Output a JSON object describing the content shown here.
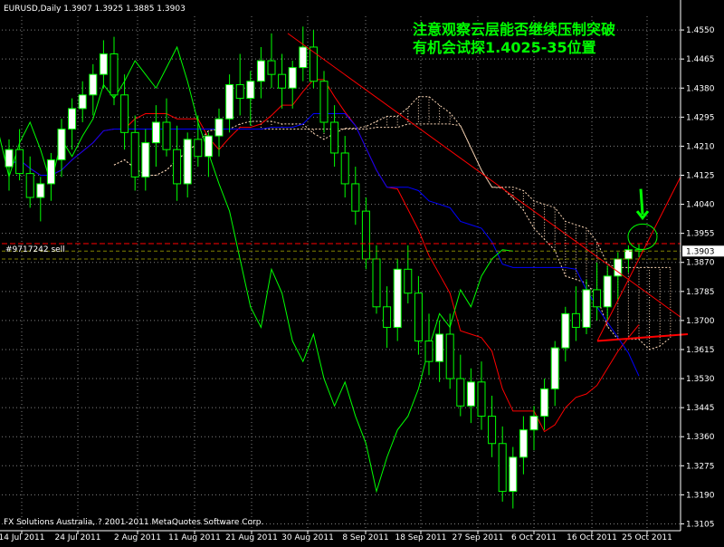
{
  "header": {
    "symbol_line": "EURUSD,Daily  1.3907 1.3925 1.3885 1.3903"
  },
  "annotation": {
    "line1": "注意观察云层能否继续压制突破",
    "line2": "有机会试探1.4025-35位置"
  },
  "order_label": "#9717242 sell",
  "price_marker": "1.3903",
  "footer": "FX Solutions Australia, ? 2001-2011 MetaQuotes Software Corp.",
  "colors": {
    "background": "#000000",
    "grid": "#808080",
    "axis": "#ffffff",
    "bull_candle": "#ffffff",
    "bear_candle": "#000000",
    "wick": "#00ff00",
    "tenkan": "#ff0000",
    "kijun": "#0000ff",
    "chikou": "#00ff00",
    "cloud_a": "#ffdab9",
    "cloud_b": "#ffdab9",
    "trendline": "#ff0000",
    "annotation_text": "#00ff00",
    "order_line": "#ff0000",
    "level_line": "#808000"
  },
  "chart_data": {
    "type": "candlestick",
    "symbol": "EURUSD",
    "timeframe": "Daily",
    "last_bar": {
      "open": 1.3907,
      "high": 1.3925,
      "low": 1.3885,
      "close": 1.3903
    },
    "ylim": [
      1.3085,
      1.459
    ],
    "y_ticks": [
      "1.4550",
      "1.4465",
      "1.4380",
      "1.4295",
      "1.4210",
      "1.4125",
      "1.4040",
      "1.3955",
      "1.3870",
      "1.3785",
      "1.3700",
      "1.3615",
      "1.3530",
      "1.3445",
      "1.3360",
      "1.3275",
      "1.3190",
      "1.3105"
    ],
    "x_ticks": [
      "14 Jul 2011",
      "24 Jul 2011",
      "2 Aug 2011",
      "11 Aug 2011",
      "21 Aug 2011",
      "30 Aug 2011",
      "8 Sep 2011",
      "18 Sep 2011",
      "27 Sep 2011",
      "6 Oct 2011",
      "16 Oct 2011",
      "25 Oct 2011"
    ],
    "grid": true,
    "candles": [
      [
        1.415,
        1.423,
        1.408,
        1.42
      ],
      [
        1.42,
        1.426,
        1.411,
        1.413
      ],
      [
        1.413,
        1.418,
        1.403,
        1.406
      ],
      [
        1.406,
        1.412,
        1.399,
        1.41
      ],
      [
        1.41,
        1.419,
        1.405,
        1.417
      ],
      [
        1.417,
        1.429,
        1.412,
        1.426
      ],
      [
        1.426,
        1.435,
        1.42,
        1.432
      ],
      [
        1.432,
        1.44,
        1.428,
        1.436
      ],
      [
        1.436,
        1.445,
        1.43,
        1.442
      ],
      [
        1.442,
        1.452,
        1.438,
        1.448
      ],
      [
        1.448,
        1.453,
        1.433,
        1.436
      ],
      [
        1.436,
        1.442,
        1.42,
        1.425
      ],
      [
        1.425,
        1.43,
        1.408,
        1.412
      ],
      [
        1.412,
        1.426,
        1.408,
        1.422
      ],
      [
        1.422,
        1.433,
        1.415,
        1.428
      ],
      [
        1.428,
        1.435,
        1.418,
        1.42
      ],
      [
        1.42,
        1.427,
        1.405,
        1.41
      ],
      [
        1.41,
        1.425,
        1.406,
        1.423
      ],
      [
        1.423,
        1.43,
        1.415,
        1.418
      ],
      [
        1.418,
        1.425,
        1.412,
        1.424
      ],
      [
        1.424,
        1.432,
        1.418,
        1.429
      ],
      [
        1.429,
        1.442,
        1.425,
        1.439
      ],
      [
        1.439,
        1.448,
        1.43,
        1.435
      ],
      [
        1.435,
        1.443,
        1.427,
        1.44
      ],
      [
        1.44,
        1.45,
        1.435,
        1.446
      ],
      [
        1.446,
        1.454,
        1.438,
        1.442
      ],
      [
        1.442,
        1.448,
        1.432,
        1.438
      ],
      [
        1.438,
        1.446,
        1.432,
        1.444
      ],
      [
        1.444,
        1.456,
        1.44,
        1.45
      ],
      [
        1.45,
        1.455,
        1.438,
        1.44
      ],
      [
        1.44,
        1.443,
        1.425,
        1.428
      ],
      [
        1.428,
        1.433,
        1.415,
        1.419
      ],
      [
        1.419,
        1.424,
        1.406,
        1.41
      ],
      [
        1.41,
        1.415,
        1.398,
        1.402
      ],
      [
        1.402,
        1.406,
        1.385,
        1.388
      ],
      [
        1.388,
        1.392,
        1.372,
        1.374
      ],
      [
        1.374,
        1.38,
        1.362,
        1.368
      ],
      [
        1.368,
        1.388,
        1.364,
        1.385
      ],
      [
        1.385,
        1.392,
        1.375,
        1.378
      ],
      [
        1.378,
        1.383,
        1.36,
        1.364
      ],
      [
        1.364,
        1.372,
        1.354,
        1.358
      ],
      [
        1.358,
        1.37,
        1.352,
        1.366
      ],
      [
        1.366,
        1.372,
        1.35,
        1.353
      ],
      [
        1.353,
        1.36,
        1.342,
        1.345
      ],
      [
        1.345,
        1.356,
        1.34,
        1.352
      ],
      [
        1.352,
        1.358,
        1.338,
        1.342
      ],
      [
        1.342,
        1.348,
        1.33,
        1.334
      ],
      [
        1.334,
        1.339,
        1.317,
        1.32
      ],
      [
        1.32,
        1.333,
        1.315,
        1.33
      ],
      [
        1.33,
        1.342,
        1.325,
        1.338
      ],
      [
        1.338,
        1.345,
        1.332,
        1.342
      ],
      [
        1.342,
        1.353,
        1.338,
        1.35
      ],
      [
        1.35,
        1.364,
        1.345,
        1.362
      ],
      [
        1.362,
        1.374,
        1.358,
        1.372
      ],
      [
        1.372,
        1.38,
        1.364,
        1.368
      ],
      [
        1.368,
        1.382,
        1.366,
        1.379
      ],
      [
        1.379,
        1.387,
        1.37,
        1.374
      ],
      [
        1.374,
        1.386,
        1.37,
        1.383
      ],
      [
        1.383,
        1.39,
        1.376,
        1.388
      ],
      [
        1.388,
        1.392,
        1.384,
        1.3907
      ],
      [
        1.3907,
        1.3925,
        1.3885,
        1.3903
      ]
    ]
  }
}
